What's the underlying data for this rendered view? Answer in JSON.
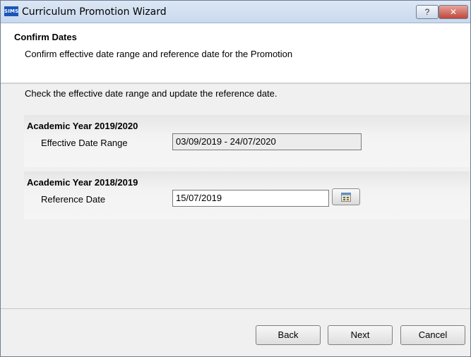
{
  "window": {
    "app_icon_text": "SIMS",
    "title": "Curriculum Promotion Wizard",
    "help_symbol": "?",
    "close_symbol": "✕"
  },
  "header": {
    "title": "Confirm Dates",
    "description": "Confirm effective date range and reference date for the Promotion"
  },
  "content": {
    "instructions": "Check the effective date range and update the reference date.",
    "groups": [
      {
        "title": "Academic Year 2019/2020",
        "field_label": "Effective Date Range",
        "field_value": "03/09/2019 - 24/07/2020"
      },
      {
        "title": "Academic Year 2018/2019",
        "field_label": "Reference Date",
        "field_value": "15/07/2019",
        "picker_icon": "calendar-icon"
      }
    ]
  },
  "footer": {
    "back_label": "Back",
    "next_label": "Next",
    "cancel_label": "Cancel"
  },
  "colors": {
    "titlebar": "#c9d9ee",
    "close_button": "#c0463a",
    "app_icon": "#1a56b8"
  }
}
